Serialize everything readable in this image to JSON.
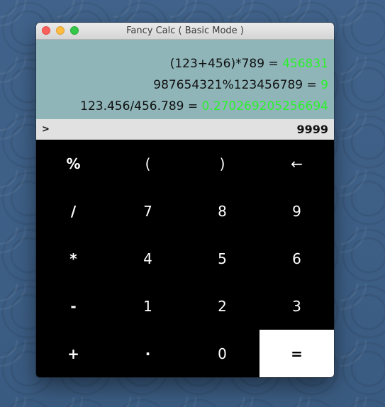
{
  "window": {
    "title": "Fancy Calc ( Basic Mode )"
  },
  "history": [
    {
      "expression": "(123+456)*789 = ",
      "result": "456831"
    },
    {
      "expression": "987654321%123456789 = ",
      "result": "9"
    },
    {
      "expression": "123.456/456.789 = ",
      "result": "0.270269205256694"
    }
  ],
  "input": {
    "prompt": ">",
    "value": "9999"
  },
  "keys": [
    [
      "%",
      "(",
      ")",
      "←"
    ],
    [
      "/",
      "7",
      "8",
      "9"
    ],
    [
      "*",
      "4",
      "5",
      "6"
    ],
    [
      "-",
      "1",
      "2",
      "3"
    ],
    [
      "+",
      "·",
      "0",
      "="
    ]
  ],
  "colors": {
    "history_bg": "#8fb5b9",
    "result_text": "#2cf02c",
    "input_bg": "#e1e1e1",
    "keypad_bg": "#000000",
    "equals_bg": "#ffffff"
  }
}
